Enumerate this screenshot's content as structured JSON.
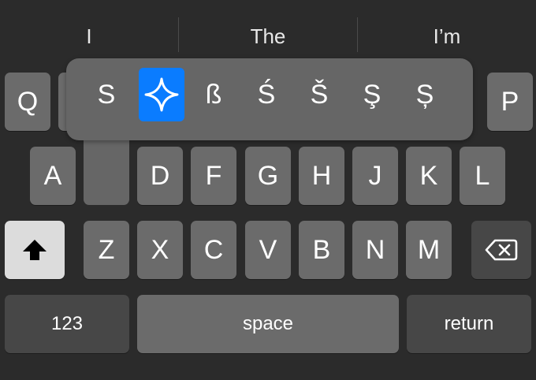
{
  "suggestions": [
    "I",
    "The",
    "I’m"
  ],
  "accent_popup": {
    "items": [
      {
        "label": "S"
      },
      {
        "label": "",
        "icon": "sparkle-icon",
        "selected": true
      },
      {
        "label": "ß"
      },
      {
        "label": "Ś"
      },
      {
        "label": "Š"
      },
      {
        "label": "Ş"
      },
      {
        "label": "Ș"
      }
    ]
  },
  "row1": [
    "Q",
    "P"
  ],
  "row2": [
    "A",
    "D",
    "F",
    "G",
    "H",
    "J",
    "K",
    "L"
  ],
  "row3": [
    "Z",
    "X",
    "C",
    "V",
    "B",
    "N",
    "M"
  ],
  "bottom": {
    "numbers_label": "123",
    "space_label": "space",
    "return_label": "return"
  },
  "icons": {
    "shift": "shift-arrow-icon",
    "delete": "delete-backspace-icon"
  },
  "colors": {
    "background": "#2b2b2b",
    "key": "#6b6b6b",
    "selected_accent": "#0a7cff"
  }
}
